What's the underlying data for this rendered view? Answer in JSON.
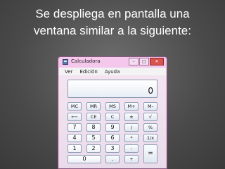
{
  "slide": {
    "caption_line1": "Se despliega en pantalla una",
    "caption_line2": "ventana similar a la siguiente:"
  },
  "window": {
    "title": "Calculadora",
    "icon": "calculator-icon",
    "controls": {
      "minimize": "–",
      "maximize": "□",
      "close": "✕"
    }
  },
  "menu": [
    "Ver",
    "Edición",
    "Ayuda"
  ],
  "display": {
    "value": "0"
  },
  "keys": {
    "mc": "MC",
    "mr": "MR",
    "ms": "MS",
    "mplus": "M+",
    "mminus": "M-",
    "backspace": "⟵",
    "ce": "CE",
    "c": "C",
    "plusminus": "±",
    "sqrt": "√",
    "n7": "7",
    "n8": "8",
    "n9": "9",
    "divide": "/",
    "percent": "%",
    "n4": "4",
    "n5": "5",
    "n6": "6",
    "multiply": "*",
    "reciprocal": "1/x",
    "n1": "1",
    "n2": "2",
    "n3": "3",
    "minus": "-",
    "equals": "=",
    "n0": "0",
    "decimal": ",",
    "plus": "+"
  }
}
